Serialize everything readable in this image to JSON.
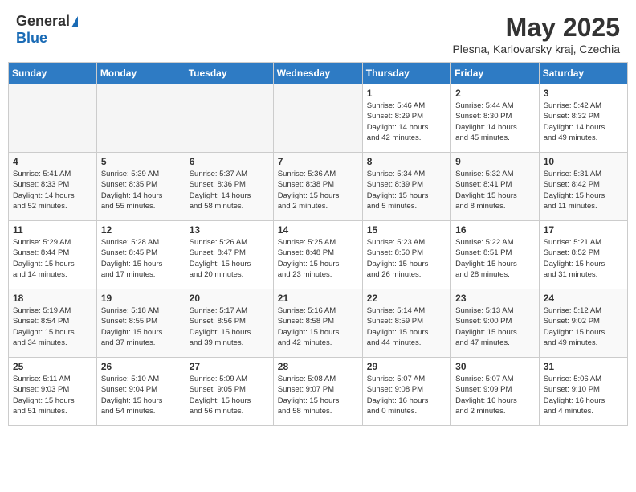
{
  "header": {
    "logo_general": "General",
    "logo_blue": "Blue",
    "month_title": "May 2025",
    "location": "Plesna, Karlovarsky kraj, Czechia"
  },
  "days_of_week": [
    "Sunday",
    "Monday",
    "Tuesday",
    "Wednesday",
    "Thursday",
    "Friday",
    "Saturday"
  ],
  "weeks": [
    [
      {
        "num": "",
        "info": ""
      },
      {
        "num": "",
        "info": ""
      },
      {
        "num": "",
        "info": ""
      },
      {
        "num": "",
        "info": ""
      },
      {
        "num": "1",
        "info": "Sunrise: 5:46 AM\nSunset: 8:29 PM\nDaylight: 14 hours\nand 42 minutes."
      },
      {
        "num": "2",
        "info": "Sunrise: 5:44 AM\nSunset: 8:30 PM\nDaylight: 14 hours\nand 45 minutes."
      },
      {
        "num": "3",
        "info": "Sunrise: 5:42 AM\nSunset: 8:32 PM\nDaylight: 14 hours\nand 49 minutes."
      }
    ],
    [
      {
        "num": "4",
        "info": "Sunrise: 5:41 AM\nSunset: 8:33 PM\nDaylight: 14 hours\nand 52 minutes."
      },
      {
        "num": "5",
        "info": "Sunrise: 5:39 AM\nSunset: 8:35 PM\nDaylight: 14 hours\nand 55 minutes."
      },
      {
        "num": "6",
        "info": "Sunrise: 5:37 AM\nSunset: 8:36 PM\nDaylight: 14 hours\nand 58 minutes."
      },
      {
        "num": "7",
        "info": "Sunrise: 5:36 AM\nSunset: 8:38 PM\nDaylight: 15 hours\nand 2 minutes."
      },
      {
        "num": "8",
        "info": "Sunrise: 5:34 AM\nSunset: 8:39 PM\nDaylight: 15 hours\nand 5 minutes."
      },
      {
        "num": "9",
        "info": "Sunrise: 5:32 AM\nSunset: 8:41 PM\nDaylight: 15 hours\nand 8 minutes."
      },
      {
        "num": "10",
        "info": "Sunrise: 5:31 AM\nSunset: 8:42 PM\nDaylight: 15 hours\nand 11 minutes."
      }
    ],
    [
      {
        "num": "11",
        "info": "Sunrise: 5:29 AM\nSunset: 8:44 PM\nDaylight: 15 hours\nand 14 minutes."
      },
      {
        "num": "12",
        "info": "Sunrise: 5:28 AM\nSunset: 8:45 PM\nDaylight: 15 hours\nand 17 minutes."
      },
      {
        "num": "13",
        "info": "Sunrise: 5:26 AM\nSunset: 8:47 PM\nDaylight: 15 hours\nand 20 minutes."
      },
      {
        "num": "14",
        "info": "Sunrise: 5:25 AM\nSunset: 8:48 PM\nDaylight: 15 hours\nand 23 minutes."
      },
      {
        "num": "15",
        "info": "Sunrise: 5:23 AM\nSunset: 8:50 PM\nDaylight: 15 hours\nand 26 minutes."
      },
      {
        "num": "16",
        "info": "Sunrise: 5:22 AM\nSunset: 8:51 PM\nDaylight: 15 hours\nand 28 minutes."
      },
      {
        "num": "17",
        "info": "Sunrise: 5:21 AM\nSunset: 8:52 PM\nDaylight: 15 hours\nand 31 minutes."
      }
    ],
    [
      {
        "num": "18",
        "info": "Sunrise: 5:19 AM\nSunset: 8:54 PM\nDaylight: 15 hours\nand 34 minutes."
      },
      {
        "num": "19",
        "info": "Sunrise: 5:18 AM\nSunset: 8:55 PM\nDaylight: 15 hours\nand 37 minutes."
      },
      {
        "num": "20",
        "info": "Sunrise: 5:17 AM\nSunset: 8:56 PM\nDaylight: 15 hours\nand 39 minutes."
      },
      {
        "num": "21",
        "info": "Sunrise: 5:16 AM\nSunset: 8:58 PM\nDaylight: 15 hours\nand 42 minutes."
      },
      {
        "num": "22",
        "info": "Sunrise: 5:14 AM\nSunset: 8:59 PM\nDaylight: 15 hours\nand 44 minutes."
      },
      {
        "num": "23",
        "info": "Sunrise: 5:13 AM\nSunset: 9:00 PM\nDaylight: 15 hours\nand 47 minutes."
      },
      {
        "num": "24",
        "info": "Sunrise: 5:12 AM\nSunset: 9:02 PM\nDaylight: 15 hours\nand 49 minutes."
      }
    ],
    [
      {
        "num": "25",
        "info": "Sunrise: 5:11 AM\nSunset: 9:03 PM\nDaylight: 15 hours\nand 51 minutes."
      },
      {
        "num": "26",
        "info": "Sunrise: 5:10 AM\nSunset: 9:04 PM\nDaylight: 15 hours\nand 54 minutes."
      },
      {
        "num": "27",
        "info": "Sunrise: 5:09 AM\nSunset: 9:05 PM\nDaylight: 15 hours\nand 56 minutes."
      },
      {
        "num": "28",
        "info": "Sunrise: 5:08 AM\nSunset: 9:07 PM\nDaylight: 15 hours\nand 58 minutes."
      },
      {
        "num": "29",
        "info": "Sunrise: 5:07 AM\nSunset: 9:08 PM\nDaylight: 16 hours\nand 0 minutes."
      },
      {
        "num": "30",
        "info": "Sunrise: 5:07 AM\nSunset: 9:09 PM\nDaylight: 16 hours\nand 2 minutes."
      },
      {
        "num": "31",
        "info": "Sunrise: 5:06 AM\nSunset: 9:10 PM\nDaylight: 16 hours\nand 4 minutes."
      }
    ]
  ]
}
